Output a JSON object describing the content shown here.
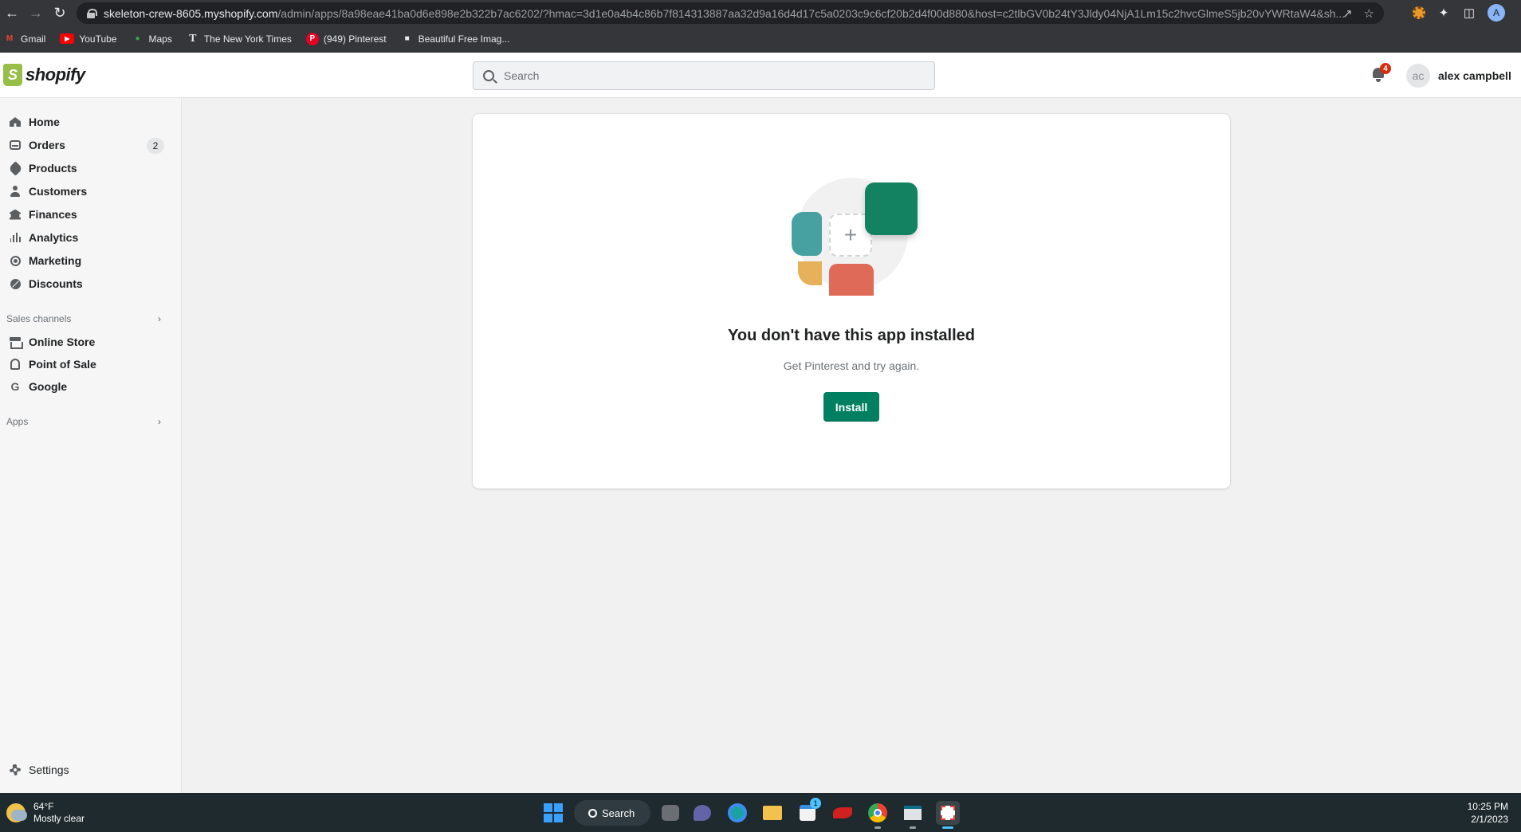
{
  "browser": {
    "url_host": "skeleton-crew-8605.myshopify.com",
    "url_path": "/admin/apps/8a98eae41ba0d6e898e2b322b7ac6202/?hmac=3d1e0a4b4c86b7f814313887aa32d9a16d4d17c5a0203c9c6cf20b2d4f00d880&host=c2tlbGV0b24tY3Jldy04NjA1Lm15c2hvcGlmeS5jb20vYWRtaW4&sh...",
    "profile_initial": "A",
    "bookmarks": [
      {
        "label": "Gmail",
        "color": "#ea4335",
        "glyph": "M"
      },
      {
        "label": "YouTube",
        "color": "#ff0000",
        "glyph": "▶"
      },
      {
        "label": "Maps",
        "color": "#34a853",
        "glyph": "●"
      },
      {
        "label": "The New York Times",
        "color": "#e8eaed",
        "glyph": "T"
      },
      {
        "label": "(949) Pinterest",
        "color": "#e60023",
        "glyph": "P"
      },
      {
        "label": "Beautiful Free Imag...",
        "color": "#e8eaed",
        "glyph": "■"
      }
    ]
  },
  "header": {
    "logo_text": "shopify",
    "search_placeholder": "Search",
    "notification_count": "4",
    "user_initials": "ac",
    "user_name": "alex campbell"
  },
  "sidebar": {
    "items": [
      {
        "label": "Home",
        "icon": "home-icon"
      },
      {
        "label": "Orders",
        "icon": "inbox-icon",
        "badge": "2"
      },
      {
        "label": "Products",
        "icon": "tag-icon"
      },
      {
        "label": "Customers",
        "icon": "person-icon"
      },
      {
        "label": "Finances",
        "icon": "bank-icon"
      },
      {
        "label": "Analytics",
        "icon": "bar-chart-icon"
      },
      {
        "label": "Marketing",
        "icon": "target-icon"
      },
      {
        "label": "Discounts",
        "icon": "discount-icon"
      }
    ],
    "sales_channels_label": "Sales channels",
    "channels": [
      {
        "label": "Online Store",
        "icon": "store-icon"
      },
      {
        "label": "Point of Sale",
        "icon": "pos-icon"
      },
      {
        "label": "Google",
        "icon": "google-icon"
      }
    ],
    "apps_label": "Apps",
    "settings_label": "Settings"
  },
  "main": {
    "title": "You don't have this app installed",
    "subtitle": "Get Pinterest and try again.",
    "install_label": "Install",
    "colors": {
      "accent": "#008060",
      "tile_green": "#128261",
      "tile_teal": "#47a1a1",
      "tile_red": "#e06a58",
      "tile_yellow": "#e6b15a"
    }
  },
  "taskbar": {
    "temperature": "64°F",
    "weather": "Mostly clear",
    "search_label": "Search",
    "store_badge": "1",
    "time": "10:25 PM",
    "date": "2/1/2023"
  }
}
